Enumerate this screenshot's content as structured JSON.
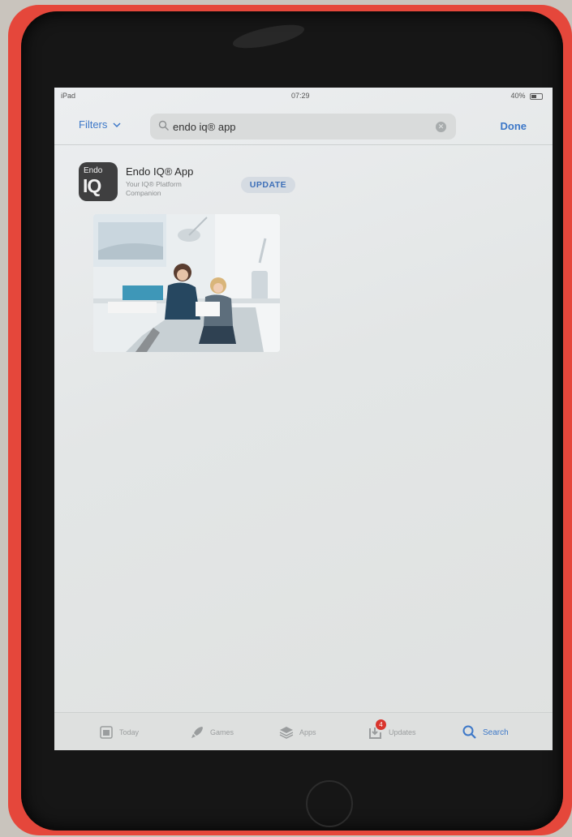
{
  "status_bar": {
    "carrier": "iPad",
    "time": "07:29",
    "battery": "40%"
  },
  "search": {
    "filters_label": "Filters",
    "query": "endo iq® app",
    "done_label": "Done"
  },
  "result": {
    "icon_top_text": "Endo",
    "icon_bottom_text": "IQ",
    "name": "Endo IQ® App",
    "subtitle": "Your IQ® Platform Companion",
    "action_label": "UPDATE"
  },
  "tab_bar": {
    "tabs": [
      {
        "label": "Today",
        "icon": "today-icon"
      },
      {
        "label": "Games",
        "icon": "rocket-icon"
      },
      {
        "label": "Apps",
        "icon": "apps-stack-icon"
      },
      {
        "label": "Updates",
        "icon": "updates-icon",
        "badge": "4"
      },
      {
        "label": "Search",
        "icon": "search-icon",
        "active": true
      }
    ]
  },
  "colors": {
    "accent": "#3d78c8",
    "badge": "#d9352d",
    "cover": "#e5473b"
  }
}
